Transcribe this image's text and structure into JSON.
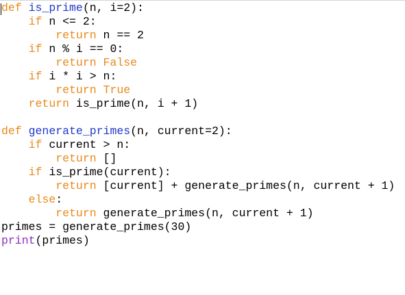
{
  "editor": {
    "lines": [
      [
        {
          "t": "def",
          "c": "kw"
        },
        {
          "t": " ",
          "c": "plain"
        },
        {
          "t": "is_prime",
          "c": "fn"
        },
        {
          "t": "(n, i=2):",
          "c": "plain"
        }
      ],
      [
        {
          "t": "    ",
          "c": "plain"
        },
        {
          "t": "if",
          "c": "kw"
        },
        {
          "t": " n <= 2:",
          "c": "plain"
        }
      ],
      [
        {
          "t": "        ",
          "c": "plain"
        },
        {
          "t": "return",
          "c": "kw"
        },
        {
          "t": " n == 2",
          "c": "plain"
        }
      ],
      [
        {
          "t": "    ",
          "c": "plain"
        },
        {
          "t": "if",
          "c": "kw"
        },
        {
          "t": " n % i == 0:",
          "c": "plain"
        }
      ],
      [
        {
          "t": "        ",
          "c": "plain"
        },
        {
          "t": "return False",
          "c": "kw"
        }
      ],
      [
        {
          "t": "    ",
          "c": "plain"
        },
        {
          "t": "if",
          "c": "kw"
        },
        {
          "t": " i * i > n:",
          "c": "plain"
        }
      ],
      [
        {
          "t": "        ",
          "c": "plain"
        },
        {
          "t": "return True",
          "c": "kw"
        }
      ],
      [
        {
          "t": "    ",
          "c": "plain"
        },
        {
          "t": "return",
          "c": "kw"
        },
        {
          "t": " is_prime(n, i + 1)",
          "c": "plain"
        }
      ],
      [],
      [
        {
          "t": "def",
          "c": "kw"
        },
        {
          "t": " ",
          "c": "plain"
        },
        {
          "t": "generate_primes",
          "c": "fn"
        },
        {
          "t": "(n, current=2):",
          "c": "plain"
        }
      ],
      [
        {
          "t": "    ",
          "c": "plain"
        },
        {
          "t": "if",
          "c": "kw"
        },
        {
          "t": " current > n:",
          "c": "plain"
        }
      ],
      [
        {
          "t": "        ",
          "c": "plain"
        },
        {
          "t": "return",
          "c": "kw"
        },
        {
          "t": " []",
          "c": "plain"
        }
      ],
      [
        {
          "t": "    ",
          "c": "plain"
        },
        {
          "t": "if",
          "c": "kw"
        },
        {
          "t": " is_prime(current):",
          "c": "plain"
        }
      ],
      [
        {
          "t": "        ",
          "c": "plain"
        },
        {
          "t": "return",
          "c": "kw"
        },
        {
          "t": " [current] + generate_primes(n, current + 1)",
          "c": "plain"
        }
      ],
      [
        {
          "t": "    ",
          "c": "plain"
        },
        {
          "t": "else",
          "c": "kw"
        },
        {
          "t": ":",
          "c": "plain"
        }
      ],
      [
        {
          "t": "        ",
          "c": "plain"
        },
        {
          "t": "return",
          "c": "kw"
        },
        {
          "t": " generate_primes(n, current + 1)",
          "c": "plain"
        }
      ],
      [
        {
          "t": "primes = generate_primes(30)",
          "c": "plain"
        }
      ],
      [
        {
          "t": "print",
          "c": "bi"
        },
        {
          "t": "(primes)",
          "c": "plain"
        }
      ]
    ]
  },
  "colors": {
    "keyword": "#e8891a",
    "function_name": "#1f39c9",
    "builtin": "#8a2fbf",
    "text": "#000000",
    "background": "#ffffff"
  }
}
